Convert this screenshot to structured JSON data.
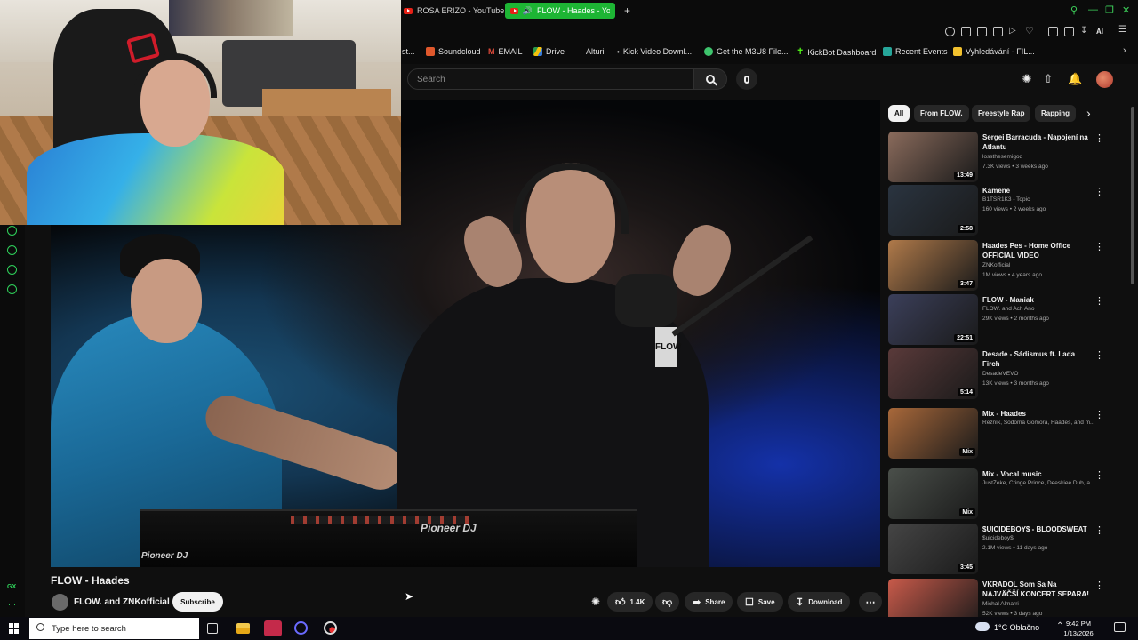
{
  "browser": {
    "tabs": [
      {
        "label": "ROSA ERIZO - YouTube",
        "active": false
      },
      {
        "label": "FLOW - Haades - YouT",
        "active": true
      }
    ],
    "accent_color": "#1db534",
    "toolbar_label": "AI"
  },
  "bookmarks": [
    {
      "label": "st...",
      "icon": "bookmark-icon"
    },
    {
      "label": "Soundcloud",
      "icon": "soundcloud-icon"
    },
    {
      "label": "EMAIL",
      "icon": "gmail-icon"
    },
    {
      "label": "Drive",
      "icon": "drive-icon"
    },
    {
      "label": "Alturi",
      "icon": "page-icon"
    },
    {
      "label": "Kick Video Downl...",
      "icon": "page-icon"
    },
    {
      "label": "Get the M3U8 File...",
      "icon": "m3u8-icon"
    },
    {
      "label": "KickBot Dashboard",
      "icon": "kickbot-icon"
    },
    {
      "label": "Recent Events",
      "icon": "events-icon"
    },
    {
      "label": "Vyhledávání - FIL...",
      "icon": "fil-icon"
    }
  ],
  "gx_sidebar": {
    "label": "GX"
  },
  "youtube": {
    "search": {
      "placeholder": "Search"
    },
    "chips": [
      "All",
      "From FLOW.",
      "Freestyle Rap",
      "Rapping"
    ],
    "video": {
      "title": "FLOW - Haades",
      "channel": "FLOW. and ZNKofficial",
      "subscribe_label": "Subscribe",
      "likes": "1.4K",
      "share_label": "Share",
      "save_label": "Save",
      "download_label": "Download",
      "deck_brand": "Pioneer DJ",
      "mic_brand": "FLOW"
    },
    "recommendations": [
      {
        "title": "Sergei Barracuda - Napojení na Atlantu",
        "channel": "lossthesemigod",
        "meta": "7.3K views • 3 weeks ago",
        "duration": "13:49",
        "thumb": "#8a6b5c"
      },
      {
        "title": "Kamene",
        "channel": "B1TSR1K3 - Topic",
        "meta": "160 views • 2 weeks ago",
        "duration": "2:58",
        "thumb": "#2a3440"
      },
      {
        "title": "Haades Pes - Home Office OFFICIAL VIDEO",
        "channel": "ZNKofficial",
        "meta": "1M views • 4 years ago",
        "duration": "3:47",
        "thumb": "#b07a4a"
      },
      {
        "title": "FLOW - Maniak",
        "channel": "FLOW. and Ach Ano",
        "meta": "29K views • 2 months ago",
        "duration": "22:51",
        "thumb": "#3b3f5a"
      },
      {
        "title": "Desade - Sádismus ft. Lada Firch",
        "channel": "DesadeVEVO",
        "meta": "13K views • 3 months ago",
        "duration": "5:14",
        "thumb": "#5a3a3a"
      },
      {
        "title": "Mix - Haades",
        "channel": "Řezník, Sodoma Gomora, Haades, and m...",
        "meta": "",
        "duration": "Mix",
        "thumb": "#a8683a"
      },
      {
        "title": "Mix - Vocal music",
        "channel": "JustŽeke, Cringe Prince, Deeskiee Dub, a...",
        "meta": "",
        "duration": "Mix",
        "thumb": "#4a4f4a"
      },
      {
        "title": "$UICIDEBOY$ - BLOODSWEAT",
        "channel": "$uicideboy$",
        "meta": "2.1M views • 11 days ago",
        "duration": "3:45",
        "thumb": "#454545"
      },
      {
        "title": "VKRADOL Som Sa Na NAJVÄČŠÍ KONCERT SEPARA!",
        "channel": "Michal Almarri",
        "meta": "52K views • 3 days ago",
        "duration": "",
        "thumb": "#c85a4a"
      }
    ]
  },
  "taskbar": {
    "search_placeholder": "Type here to search",
    "weather": "1°C  Oblačno",
    "time": "9:42 PM",
    "date": "1/13/2026"
  }
}
